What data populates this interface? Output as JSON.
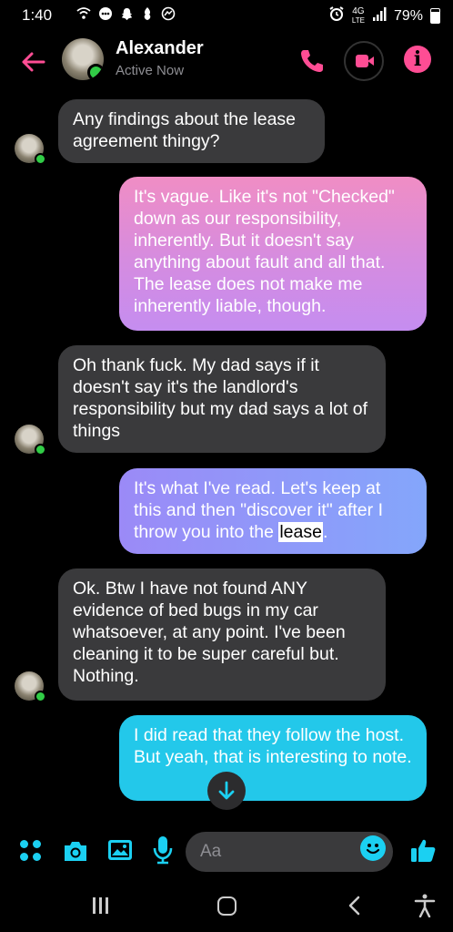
{
  "status_bar": {
    "time": "1:40",
    "battery": "79%",
    "network": "4G",
    "network_sub": "LTE",
    "battery_level": 0.79
  },
  "header": {
    "contact_name": "Alexander",
    "presence": "Active Now",
    "accent_color": "#ff4d94"
  },
  "messages": [
    {
      "direction": "incoming",
      "text": "Any findings about the lease agreement thingy?"
    },
    {
      "direction": "outgoing",
      "text": "It's vague. Like it's not \"Checked\" down as our responsibility, inherently. But it doesn't say anything about fault and all that. The lease does not make me inherently liable, though."
    },
    {
      "direction": "incoming",
      "text": "Oh thank fuck. My dad says if it doesn't say it's the landlord's responsibility but my dad says a lot of things"
    },
    {
      "direction": "outgoing",
      "text_before": "It's what I've read. Let's keep at this and then \"discover it\" after I throw you into the ",
      "text_highlight": "lease",
      "text_after": "."
    },
    {
      "direction": "incoming",
      "text": "Ok. Btw I have not found ANY evidence of bed bugs in my car whatsoever, at any point. I've been cleaning it to be super careful but. Nothing."
    },
    {
      "direction": "outgoing",
      "text": "I did read that they follow the host. But yeah, that is interesting to note."
    }
  ],
  "composer": {
    "placeholder": "Aa",
    "accent_color": "#1bd0f2"
  },
  "icons": {
    "back": "back-arrow-icon",
    "phone": "phone-icon",
    "video": "video-icon",
    "info": "info-icon",
    "apps": "apps-icon",
    "camera": "camera-icon",
    "gallery": "image-icon",
    "mic": "microphone-icon",
    "emoji": "emoji-icon",
    "like": "thumbs-up-icon",
    "scroll": "scroll-down-icon"
  }
}
